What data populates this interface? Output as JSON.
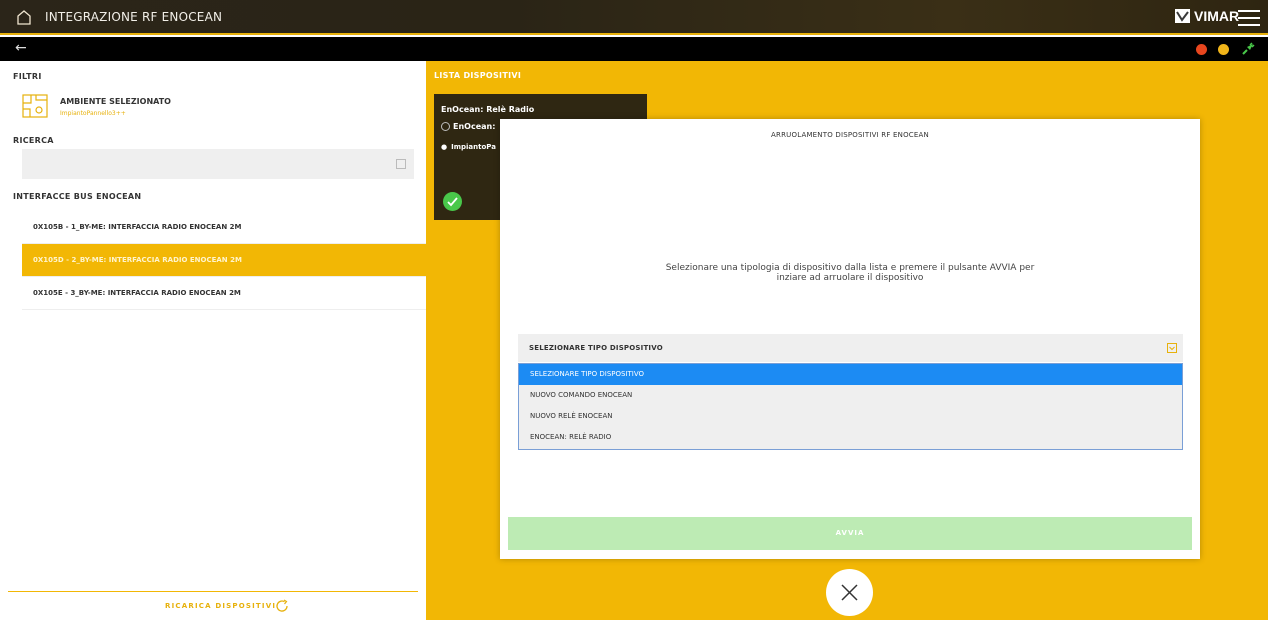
{
  "header": {
    "title": "INTEGRAZIONE RF ENOCEAN",
    "brand": "VIMAR"
  },
  "colors": {
    "accent": "#f2b705",
    "status_red": "#e8461e",
    "status_yellow": "#f1b51a",
    "status_green": "#49c84a",
    "selection_blue": "#1c8bf3"
  },
  "filters": {
    "label": "FILTRI",
    "ambiente_title": "AMBIENTE SELEZIONATO",
    "ambiente_value": "ImpiantoPannello3++",
    "ricerca_label": "RICERCA",
    "search_value": ""
  },
  "interfaces": {
    "label": "INTERFACCE BUS ENOCEAN",
    "items": [
      "0X105B - 1_BY-ME: INTERFACCIA RADIO ENOCEAN 2M",
      "0X105D - 2_BY-ME: INTERFACCIA RADIO ENOCEAN 2M",
      "0X105E - 3_BY-ME: INTERFACCIA RADIO ENOCEAN 2M"
    ],
    "selected_index": 1
  },
  "reload_label": "RICARICA DISPOSITIVI",
  "devices": {
    "label": "LISTA DISPOSITIVI",
    "card": {
      "title": "EnOcean: Relè Radio",
      "type": "EnOcean: ",
      "place": "ImpiantoPa"
    }
  },
  "modal": {
    "title": "ARRUOLAMENTO DISPOSITIVI RF ENOCEAN",
    "message": "Selezionare una tipologia di dispositivo dalla lista e premere il pulsante AVVIA per inziare ad arruolare il dispositivo",
    "select_value": "SELEZIONARE TIPO DISPOSITIVO",
    "options": [
      "SELEZIONARE TIPO DISPOSITIVO",
      "NUOVO COMANDO ENOCEAN",
      "NUOVO RELÈ ENOCEAN",
      "ENOCEAN: RELÈ RADIO"
    ],
    "start_label": "AVVIA"
  }
}
